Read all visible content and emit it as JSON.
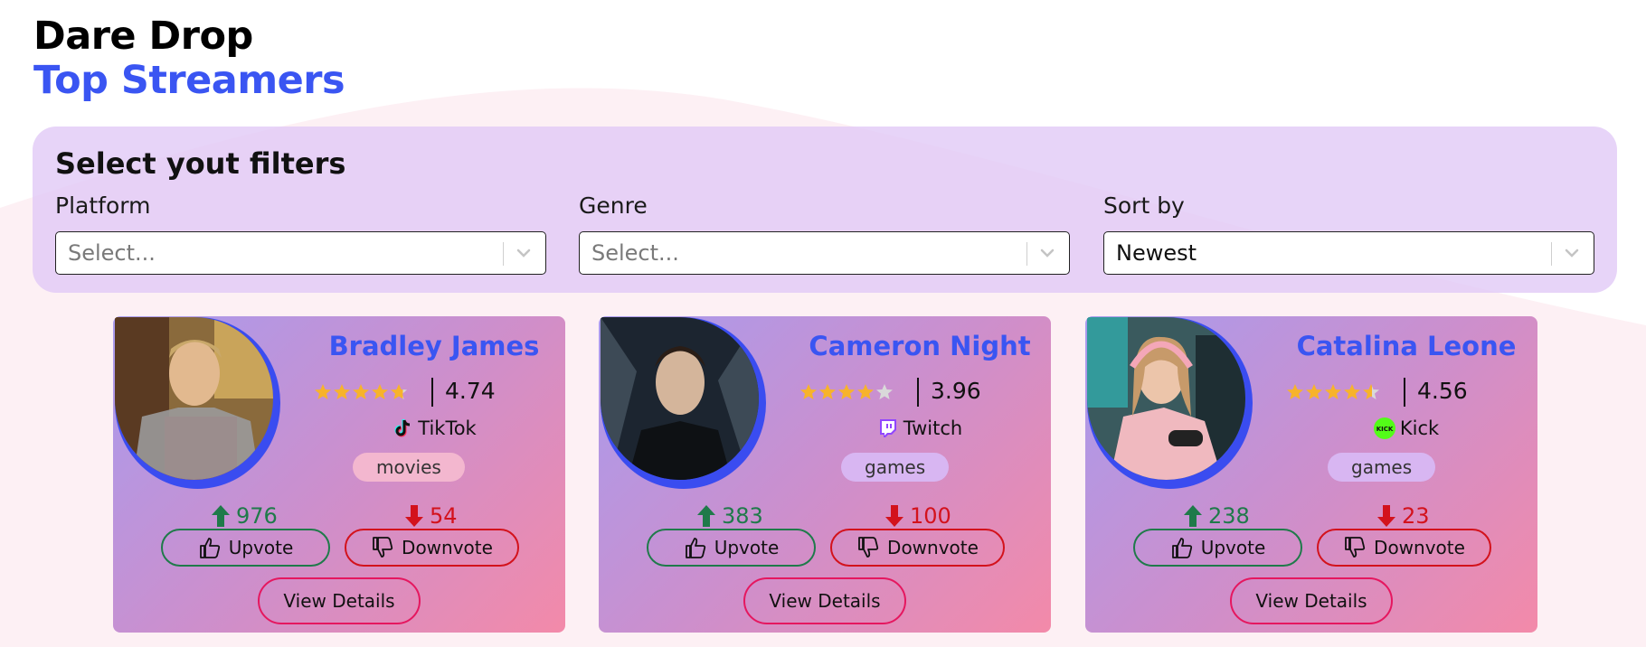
{
  "header": {
    "app_title": "Dare Drop",
    "page_title": "Top Streamers"
  },
  "filters": {
    "heading": "Select yout filters",
    "platform": {
      "label": "Platform",
      "placeholder": "Select..."
    },
    "genre": {
      "label": "Genre",
      "placeholder": "Select..."
    },
    "sort": {
      "label": "Sort by",
      "value": "Newest"
    }
  },
  "colors": {
    "accent": "#3a55f2",
    "upvote": "#1f7a4a",
    "downvote": "#d3121c",
    "details_border": "#e5175f",
    "star": "#f7b32b",
    "star_empty": "#d9d9d9"
  },
  "buttons": {
    "upvote": "Upvote",
    "downvote": "Downvote",
    "details": "View Details"
  },
  "streamers": [
    {
      "name": "Bradley James",
      "rating": "4.74",
      "rating_value": 4.74,
      "platform": "TikTok",
      "platform_icon": "tiktok-icon",
      "genre": "movies",
      "upvotes": "976",
      "downvotes": "54"
    },
    {
      "name": "Cameron Night",
      "rating": "3.96",
      "rating_value": 3.96,
      "platform": "Twitch",
      "platform_icon": "twitch-icon",
      "genre": "games",
      "upvotes": "383",
      "downvotes": "100"
    },
    {
      "name": "Catalina Leone",
      "rating": "4.56",
      "rating_value": 4.56,
      "platform": "Kick",
      "platform_icon": "kick-icon",
      "genre": "games",
      "upvotes": "238",
      "downvotes": "23"
    }
  ]
}
